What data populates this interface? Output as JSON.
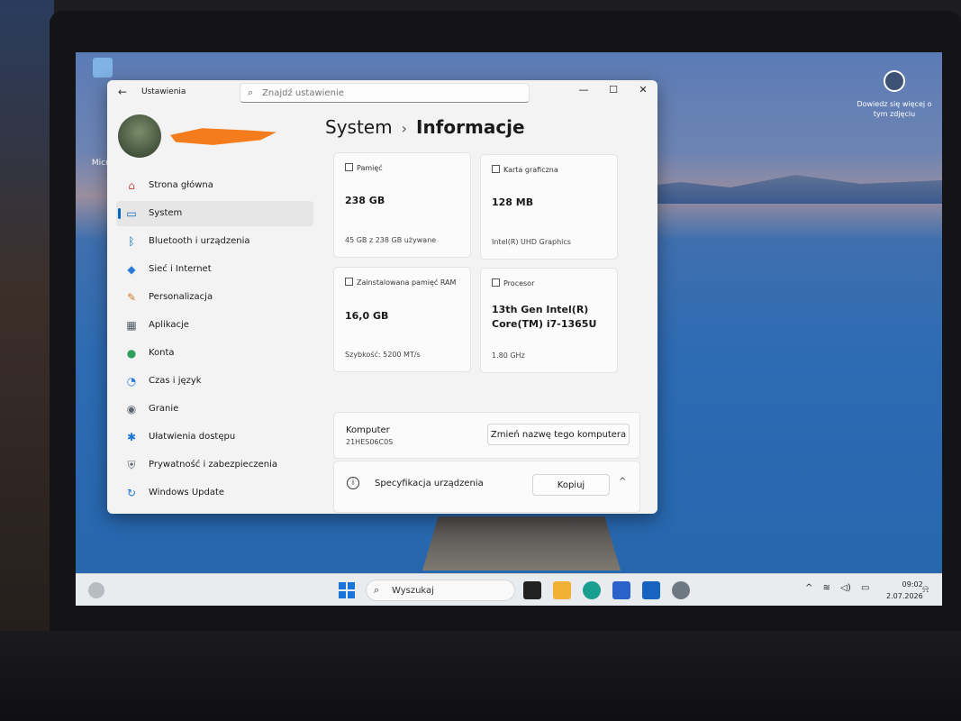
{
  "desktop": {
    "icon_label": "Micro",
    "spotlight_text": "Dowiedz się więcej o tym zdjęciu"
  },
  "window": {
    "app_title": "Ustawienia",
    "search_placeholder": "Znajdź ustawienie",
    "min_glyph": "—",
    "max_glyph": "☐",
    "close_glyph": "✕"
  },
  "sidebar": {
    "items": [
      {
        "label": "Strona główna",
        "icon": "home-icon",
        "glyph": "⌂",
        "color": "#c0504d"
      },
      {
        "label": "System",
        "icon": "system-icon",
        "glyph": "▭",
        "color": "#0067c0",
        "active": true
      },
      {
        "label": "Bluetooth i urządzenia",
        "icon": "bluetooth-icon",
        "glyph": "ᛒ",
        "color": "#0067c0"
      },
      {
        "label": "Sieć i Internet",
        "icon": "wifi-icon",
        "glyph": "◆",
        "color": "#2b7bd6"
      },
      {
        "label": "Personalizacja",
        "icon": "brush-icon",
        "glyph": "✎",
        "color": "#d07a2a"
      },
      {
        "label": "Aplikacje",
        "icon": "apps-icon",
        "glyph": "▦",
        "color": "#4f5b66"
      },
      {
        "label": "Konta",
        "icon": "account-icon",
        "glyph": "●",
        "color": "#2e9e5a"
      },
      {
        "label": "Czas i język",
        "icon": "clock-globe-icon",
        "glyph": "◔",
        "color": "#2b7bd6"
      },
      {
        "label": "Granie",
        "icon": "gamepad-icon",
        "glyph": "◉",
        "color": "#5a6570"
      },
      {
        "label": "Ułatwienia dostępu",
        "icon": "accessibility-icon",
        "glyph": "✱",
        "color": "#1a73d8"
      },
      {
        "label": "Prywatność i zabezpieczenia",
        "icon": "shield-icon",
        "glyph": "⛨",
        "color": "#5a6570"
      },
      {
        "label": "Windows Update",
        "icon": "update-icon",
        "glyph": "↻",
        "color": "#1a73d8"
      }
    ]
  },
  "content": {
    "breadcrumb_parent": "System",
    "breadcrumb_sep": "›",
    "breadcrumb_current": "Informacje",
    "cards": {
      "memory": {
        "title": "Pamięć",
        "value": "238 GB",
        "sub": "45 GB z 238 GB używane"
      },
      "gpu": {
        "title": "Karta graficzna",
        "value": "128 MB",
        "sub": "Intel(R) UHD Graphics"
      },
      "ram": {
        "title": "Zainstalowana pamięć RAM",
        "value": "16,0 GB",
        "sub": "Szybkość: 5200 MT/s"
      },
      "cpu": {
        "title": "Procesor",
        "value": "13th Gen Intel(R) Core(TM) i7-1365U",
        "sub": "1.80 GHz"
      }
    },
    "computer": {
      "title": "Komputer",
      "name": "21HES06C0S",
      "rename_label": "Zmień nazwę tego komputera"
    },
    "spec": {
      "title": "Specyfikacja urządzenia",
      "copy_label": "Kopiuj",
      "info_glyph": "i",
      "chevron": "^"
    }
  },
  "taskbar": {
    "search_label": "Wyszukaj",
    "time": "09:02",
    "date": "2.07.2026",
    "tray_up": "^",
    "tray_wifi": "≋",
    "tray_volume": "◁)",
    "tray_battery": "▭"
  }
}
